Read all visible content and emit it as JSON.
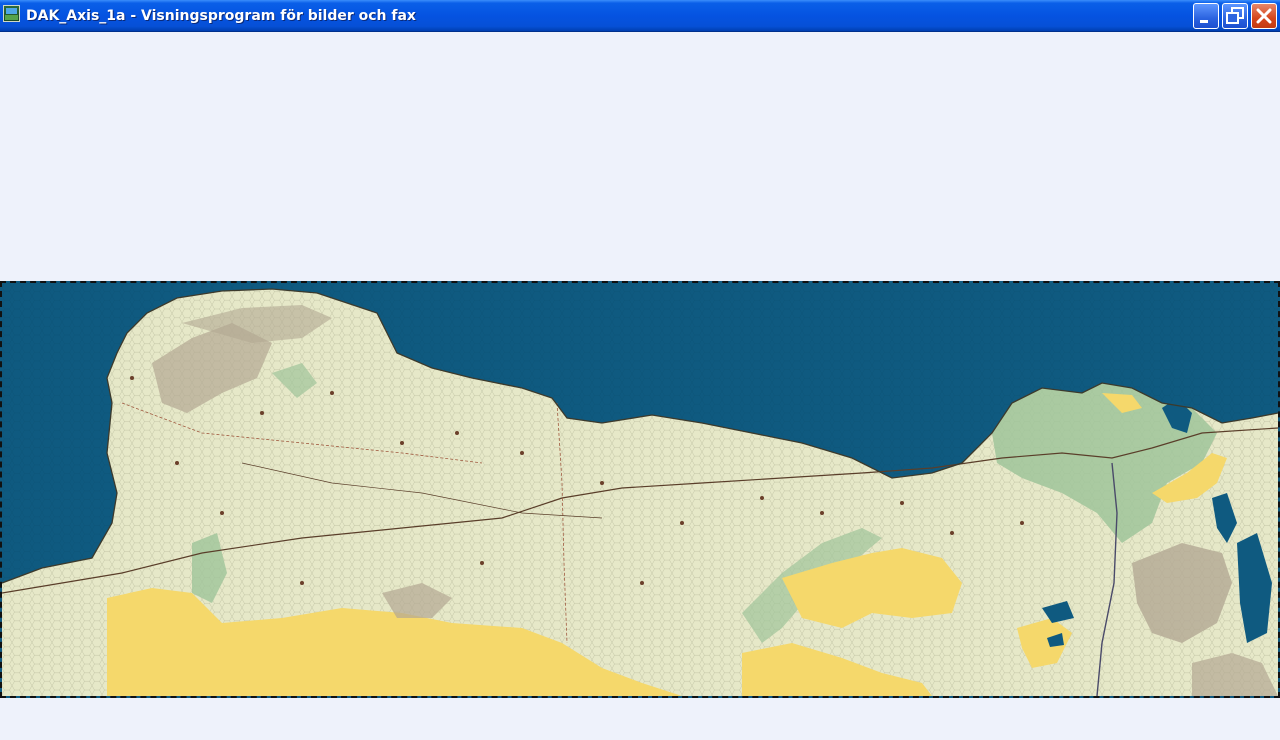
{
  "window": {
    "title": "DAK_Axis_1a - Visningsprogram för bilder och fax",
    "buttons": {
      "minimize": "minimize-icon",
      "maximize": "restore-icon",
      "close": "close-icon"
    }
  },
  "viewer": {
    "background_color": "#eef2fb",
    "image": {
      "subject": "hex map",
      "colors": {
        "sea": "#0f5a80",
        "land": "#e6e8c8",
        "sand": "#f5d86b",
        "rough": "#b3a893",
        "marsh": "#9fc49a"
      }
    }
  }
}
